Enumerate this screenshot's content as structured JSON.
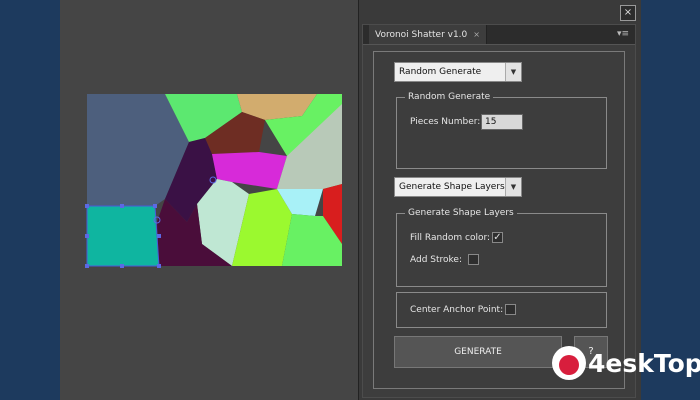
{
  "panel": {
    "tab_title": "Voronoi Shatter v1.0",
    "tab_close": "×",
    "menu_glyph": "▾≡",
    "window_close": "×"
  },
  "controls": {
    "mode_dropdown": "Random Generate",
    "random_group_title": "Random Generate",
    "pieces_label": "Pieces Number:",
    "pieces_value": "15",
    "output_dropdown": "Generate Shape Layers",
    "shape_group_title": "Generate Shape Layers",
    "fill_random_label": "Fill Random color:",
    "fill_random_checked": true,
    "add_stroke_label": "Add Stroke:",
    "add_stroke_checked": false,
    "center_anchor_label": "Center Anchor Point:",
    "center_anchor_checked": false,
    "generate_label": "GENERATE",
    "help_label": "?"
  },
  "watermark": {
    "text": "4eskTop"
  },
  "colors": {
    "background": "#1d3a5e",
    "workspace": "#454545",
    "panel": "#3d3d3d",
    "cells": [
      "#4d5f7d",
      "#5ce870",
      "#d2ac6e",
      "#6e2d23",
      "#3a1145",
      "#d72ad9",
      "#b8c9b8",
      "#3ea8a0",
      "#bfe7d3",
      "#9bf92f",
      "#a8f1f7",
      "#d81e1e",
      "#68f163",
      "#4a0d3a",
      "#0fb5a0"
    ]
  }
}
